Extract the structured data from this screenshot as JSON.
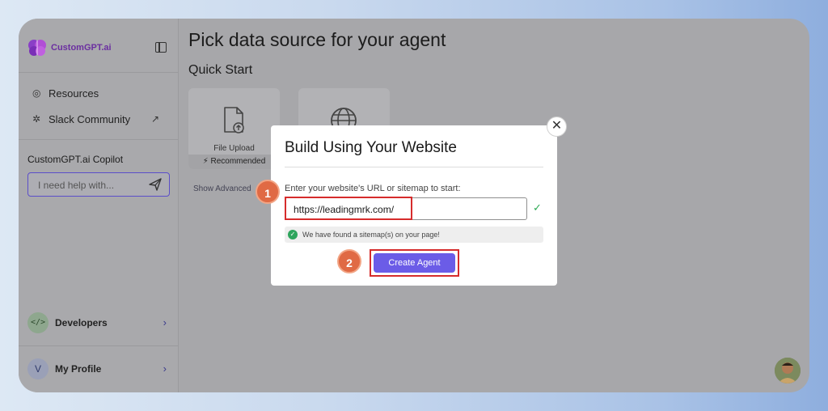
{
  "sidebar": {
    "brand": "CustomGPT.ai",
    "nav": [
      {
        "label": "Resources",
        "icon": "help-circle-icon"
      },
      {
        "label": "Slack Community",
        "icon": "slack-icon"
      }
    ],
    "copilot_title": "CustomGPT.ai Copilot",
    "copilot_placeholder": "I need help with...",
    "developers_label": "Developers",
    "developers_badge": "</>",
    "profile_label": "My Profile",
    "profile_initial": "V"
  },
  "main": {
    "page_title": "Pick data source for your agent",
    "section_title": "Quick Start",
    "cards": [
      {
        "label": "File Upload",
        "badge": "⚡ Recommended",
        "icon": "file-upload-icon"
      },
      {
        "label": "",
        "badge": "",
        "icon": "globe-icon"
      }
    ],
    "show_advanced": "Show Advanced"
  },
  "modal": {
    "title": "Build Using Your Website",
    "url_label": "Enter your website's URL or sitemap to start:",
    "url_value": "https://leadingmrk.com/",
    "found_message": "We have found a sitemap(s) on your page!",
    "create_button": "Create Agent",
    "close_icon": "close-icon"
  },
  "annotations": {
    "step1": "1",
    "step2": "2"
  },
  "colors": {
    "accent": "#6b5ce7",
    "highlight": "#d62c2c",
    "step_badge": "#e06a44",
    "success": "#2ea55d"
  }
}
